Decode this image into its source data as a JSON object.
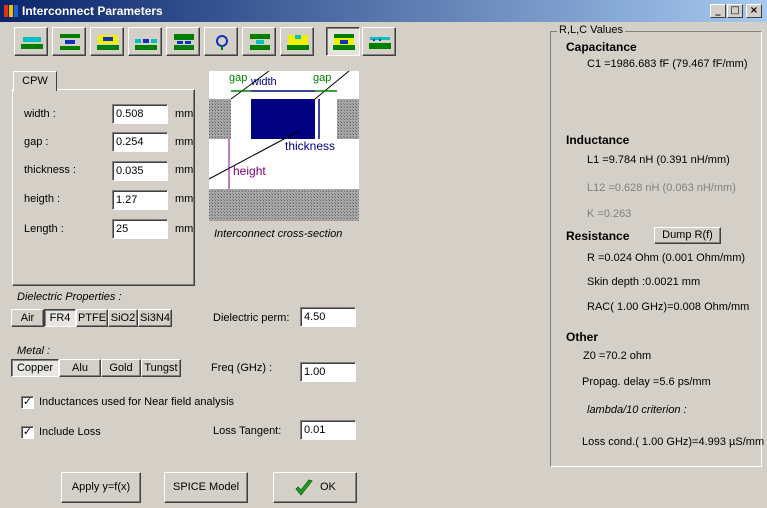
{
  "window": {
    "title": "Interconnect Parameters",
    "minimize": "_",
    "maximize": "□",
    "close": "×"
  },
  "toolbar": {
    "buttons": [
      {
        "name": "cpw",
        "selected": false
      },
      {
        "name": "stripline",
        "selected": false
      },
      {
        "name": "microstrip",
        "selected": false
      },
      {
        "name": "coplanar-gnd",
        "selected": false
      },
      {
        "name": "embedded",
        "selected": false
      },
      {
        "name": "wire",
        "selected": false
      },
      {
        "name": "coupled",
        "selected": false
      },
      {
        "name": "pad",
        "selected": false
      },
      {
        "name": "cpw-selected",
        "selected": true
      },
      {
        "name": "multi",
        "selected": false
      }
    ]
  },
  "cpw_tab": {
    "tab_label": "CPW",
    "fields": [
      {
        "label": "width :",
        "value": "0.508",
        "unit": "mm"
      },
      {
        "label": "gap :",
        "value": "0.254",
        "unit": "mm"
      },
      {
        "label": "thickness :",
        "value": "0.035",
        "unit": "mm"
      },
      {
        "label": "heigth :",
        "value": "1.27",
        "unit": "mm"
      },
      {
        "label": "Length :",
        "value": "25",
        "unit": "mm"
      }
    ]
  },
  "cross_section": {
    "caption": "Interconnect cross-section",
    "gap_left": "gap",
    "width": "width",
    "gap_right": "gap",
    "thickness": "thickness",
    "height": "height"
  },
  "dielectric": {
    "group_label": "Dielectric Properties :",
    "options": [
      "Air",
      "FR4",
      "PTFE",
      "SiO2",
      "Si3N4"
    ],
    "selected": "FR4",
    "perm_label": "Dielectric perm:",
    "perm_value": "4.50"
  },
  "metal": {
    "group_label": "Metal :",
    "options": [
      "Copper",
      "Alu",
      "Gold",
      "Tungst"
    ],
    "selected": "Copper",
    "freq_label": "Freq (GHz) :",
    "freq_value": "1.00"
  },
  "options": {
    "near_field_label": "Inductances used for Near field analysis",
    "near_field_checked": true,
    "include_loss_label": "Include Loss",
    "include_loss_checked": true,
    "loss_tangent_label": "Loss Tangent:",
    "loss_tangent_value": "0.01"
  },
  "buttons": {
    "apply": "Apply y=f(x)",
    "spice": "SPICE Model",
    "ok": "OK"
  },
  "results": {
    "group_label": "R,L,C Values",
    "capacitance_title": "Capacitance",
    "c1": "C1 =1986.683 fF (79.467 fF/mm)",
    "inductance_title": "Inductance",
    "l1": "L1 =9.784 nH (0.391 nH/mm)",
    "l12": "L12 =0.628 nH (0.063 nH/mm)",
    "k": "K =0.263",
    "resistance_title": "Resistance",
    "dump_button": "Dump R(f)",
    "r": "R =0.024 Ohm (0.001 Ohm/mm)",
    "skin_depth": "Skin depth :0.0021 mm",
    "rac": "RAC( 1.00 GHz)=0.008 Ohm/mm",
    "other_title": "Other",
    "z0": "Z0 =70.2 ohm",
    "propag_delay": "Propag. delay =5.6 ps/mm",
    "lambda_criterion": "lambda/10 criterion :",
    "loss_cond": "Loss cond.( 1.00 GHz)=4.993 µS/mm"
  }
}
